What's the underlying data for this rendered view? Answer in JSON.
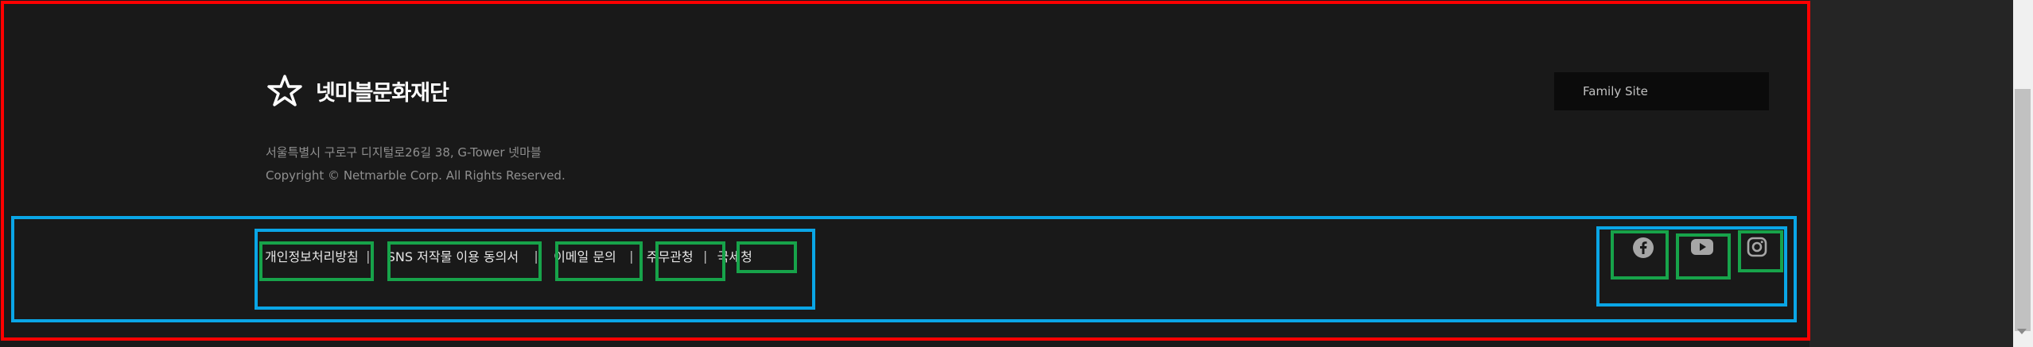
{
  "brand": {
    "logo_text": "넷마블문화재단"
  },
  "info": {
    "address": "서울특별시 구로구 디지털로26길 38, G-Tower 넷마블",
    "copyright": "Copyright © Netmarble Corp. All Rights Reserved."
  },
  "family_site": {
    "label": "Family Site"
  },
  "footer_links": [
    {
      "label": "개인정보처리방침"
    },
    {
      "label": "SNS 저작물 이용 동의서"
    },
    {
      "label": "이메일 문의"
    },
    {
      "label": "주무관청"
    },
    {
      "label": "국세청"
    }
  ],
  "separator": "|",
  "social": [
    {
      "icon": "facebook-icon"
    },
    {
      "icon": "youtube-icon"
    },
    {
      "icon": "instagram-icon"
    }
  ],
  "colors": {
    "background": "#191919",
    "annotation_red": "#ff0000",
    "annotation_blue": "#0aa6e6",
    "annotation_green": "#17a34a",
    "icon": "#a6a6a6"
  }
}
